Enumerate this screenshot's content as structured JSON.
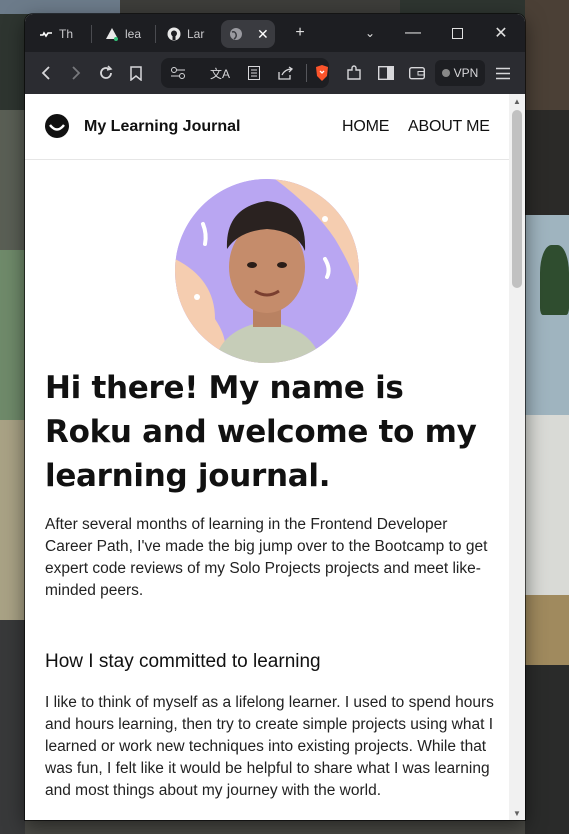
{
  "browser": {
    "tabs": [
      {
        "label": "Th",
        "icon": "wave-icon"
      },
      {
        "label": "lea",
        "icon": "triangle-icon"
      },
      {
        "label": "Lar",
        "icon": "github-icon"
      },
      {
        "label": "",
        "icon": "globe-icon",
        "active": true
      }
    ],
    "vpn_label": "VPN"
  },
  "site": {
    "title": "My Learning Journal",
    "nav": [
      "HOME",
      "ABOUT ME"
    ]
  },
  "content": {
    "heading": "Hi there! My name is Roku and welcome to my learning journal.",
    "intro": "After several months of learning in the Frontend Developer Career Path, I've made the big jump over to the Bootcamp to get expert code reviews of my Solo Projects projects and meet like-minded peers.",
    "subheading": "How I stay committed to learning",
    "body": "I like to think of myself as a lifelong learner. I used to spend hours and hours learning, then try to create simple projects using what I learned or work new techniques into existing projects. While that was fun, I felt like it would be helpful to share what I was learning and most things about my journey with the world."
  },
  "colors": {
    "avatar_bg": "#b9a6f2",
    "avatar_blob": "#f5cdb0"
  }
}
